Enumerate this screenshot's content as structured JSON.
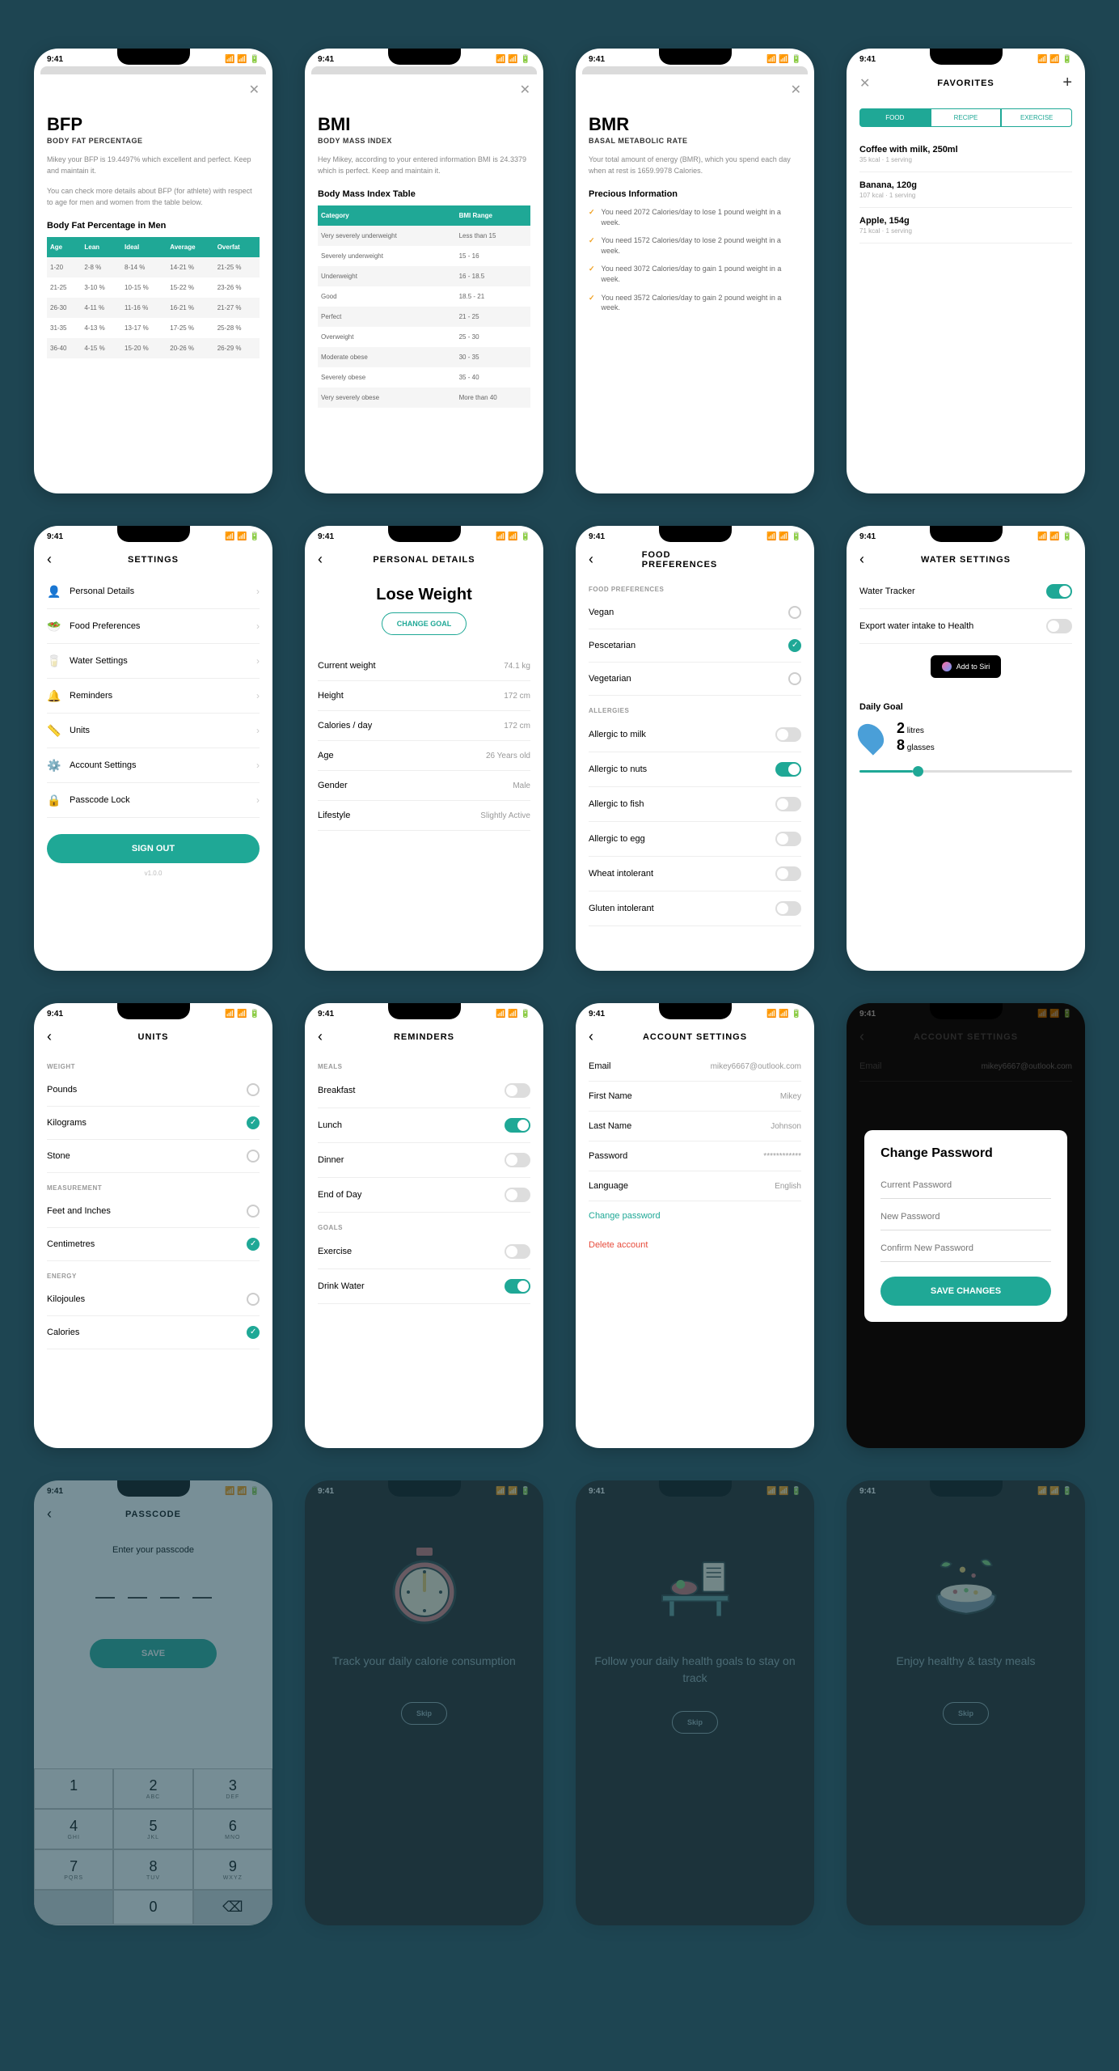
{
  "statusbar": {
    "time": "9:41"
  },
  "bfp": {
    "title": "BFP",
    "subtitle": "BODY FAT PERCENTAGE",
    "desc1": "Mikey your BFP is 19.4497% which excellent and perfect. Keep and maintain it.",
    "desc2": "You can check more details about BFP (for athlete) with respect to age for men and women from the table below.",
    "table_title": "Body Fat Percentage in Men",
    "headers": [
      "Age",
      "Lean",
      "Ideal",
      "Average",
      "Overfat"
    ],
    "rows": [
      [
        "1-20",
        "2-8 %",
        "8-14 %",
        "14-21 %",
        "21-25 %"
      ],
      [
        "21-25",
        "3-10 %",
        "10-15 %",
        "15-22 %",
        "23-26 %"
      ],
      [
        "26-30",
        "4-11 %",
        "11-16 %",
        "16-21 %",
        "21-27 %"
      ],
      [
        "31-35",
        "4-13 %",
        "13-17 %",
        "17-25 %",
        "25-28 %"
      ],
      [
        "36-40",
        "4-15 %",
        "15-20 %",
        "20-26 %",
        "26-29 %"
      ]
    ]
  },
  "bmi": {
    "title": "BMI",
    "subtitle": "BODY MASS INDEX",
    "desc": "Hey Mikey, according to your entered information BMI is 24.3379 which is perfect. Keep and maintain it.",
    "table_title": "Body Mass Index Table",
    "headers": [
      "Category",
      "BMI Range"
    ],
    "rows": [
      [
        "Very severely underweight",
        "Less than 15"
      ],
      [
        "Severely underweight",
        "15 - 16"
      ],
      [
        "Underweight",
        "16 - 18.5"
      ],
      [
        "Good",
        "18.5 - 21"
      ],
      [
        "Perfect",
        "21 - 25"
      ],
      [
        "Overweight",
        "25 - 30"
      ],
      [
        "Moderate obese",
        "30 - 35"
      ],
      [
        "Severely obese",
        "35 - 40"
      ],
      [
        "Very severely obese",
        "More than 40"
      ]
    ]
  },
  "bmr": {
    "title": "BMR",
    "subtitle": "BASAL METABOLIC RATE",
    "desc": "Your total amount of energy (BMR), which you spend each day when at rest is 1659.9978 Calories.",
    "info_title": "Precious Information",
    "items": [
      "You need 2072 Calories/day to lose 1 pound weight in a week.",
      "You need 1572 Calories/day to lose 2 pound weight in a week.",
      "You need 3072 Calories/day to gain 1 pound weight in a week.",
      "You need 3572 Calories/day to gain 2 pound weight in a week."
    ]
  },
  "favorites": {
    "title": "FAVORITES",
    "tabs": [
      "FOOD",
      "RECIPE",
      "EXERCISE"
    ],
    "items": [
      {
        "name": "Coffee with milk, 250ml",
        "meta": "35 kcal · 1 serving"
      },
      {
        "name": "Banana, 120g",
        "meta": "107 kcal · 1 serving"
      },
      {
        "name": "Apple, 154g",
        "meta": "71 kcal · 1 serving"
      }
    ]
  },
  "settings": {
    "title": "SETTINGS",
    "items": [
      "Personal Details",
      "Food Preferences",
      "Water Settings",
      "Reminders",
      "Units",
      "Account Settings",
      "Passcode Lock"
    ],
    "signout": "SIGN OUT",
    "version": "v1.0.0"
  },
  "personal": {
    "title": "PERSONAL DETAILS",
    "goal": "Lose Weight",
    "change": "CHANGE GOAL",
    "rows": [
      {
        "k": "Current weight",
        "v": "74.1 kg"
      },
      {
        "k": "Height",
        "v": "172 cm"
      },
      {
        "k": "Calories / day",
        "v": "172 cm"
      },
      {
        "k": "Age",
        "v": "26 Years old"
      },
      {
        "k": "Gender",
        "v": "Male"
      },
      {
        "k": "Lifestyle",
        "v": "Slightly Active"
      }
    ]
  },
  "foodprefs": {
    "title": "FOOD PREFERENCES",
    "sect1": "FOOD PREFERENCES",
    "prefs": [
      {
        "k": "Vegan",
        "on": false
      },
      {
        "k": "Pescetarian",
        "on": true
      },
      {
        "k": "Vegetarian",
        "on": false
      }
    ],
    "sect2": "ALLERGIES",
    "allergies": [
      {
        "k": "Allergic to milk",
        "on": false
      },
      {
        "k": "Allergic to nuts",
        "on": true
      },
      {
        "k": "Allergic to fish",
        "on": false
      },
      {
        "k": "Allergic to egg",
        "on": false
      },
      {
        "k": "Wheat intolerant",
        "on": false
      },
      {
        "k": "Gluten intolerant",
        "on": false
      }
    ]
  },
  "water": {
    "title": "WATER SETTINGS",
    "rows": [
      {
        "k": "Water Tracker",
        "on": true
      },
      {
        "k": "Export water intake to Health",
        "on": false
      }
    ],
    "siri": "Add to Siri",
    "goal_title": "Daily Goal",
    "litres_n": "2",
    "litres_u": "litres",
    "glasses_n": "8",
    "glasses_u": "glasses"
  },
  "units": {
    "title": "UNITS",
    "weight_label": "WEIGHT",
    "weight": [
      {
        "k": "Pounds",
        "on": false
      },
      {
        "k": "Kilograms",
        "on": true
      },
      {
        "k": "Stone",
        "on": false
      }
    ],
    "meas_label": "MEASUREMENT",
    "meas": [
      {
        "k": "Feet and Inches",
        "on": false
      },
      {
        "k": "Centimetres",
        "on": true
      }
    ],
    "energy_label": "ENERGY",
    "energy": [
      {
        "k": "Kilojoules",
        "on": false
      },
      {
        "k": "Calories",
        "on": true
      }
    ]
  },
  "reminders": {
    "title": "REMINDERS",
    "meals_label": "MEALS",
    "meals": [
      {
        "k": "Breakfast",
        "on": false
      },
      {
        "k": "Lunch",
        "on": true
      },
      {
        "k": "Dinner",
        "on": false
      },
      {
        "k": "End of Day",
        "on": false
      }
    ],
    "goals_label": "GOALS",
    "goals": [
      {
        "k": "Exercise",
        "on": false
      },
      {
        "k": "Drink Water",
        "on": true
      }
    ]
  },
  "account": {
    "title": "ACCOUNT SETTINGS",
    "rows": [
      {
        "k": "Email",
        "v": "mikey6667@outlook.com"
      },
      {
        "k": "First Name",
        "v": "Mikey"
      },
      {
        "k": "Last Name",
        "v": "Johnson"
      },
      {
        "k": "Password",
        "v": "************"
      },
      {
        "k": "Language",
        "v": "English"
      }
    ],
    "change_pw": "Change password",
    "delete": "Delete account"
  },
  "changepw": {
    "title": "Change Password",
    "f1": "Current Password",
    "f2": "New Password",
    "f3": "Confirm New Password",
    "save": "SAVE CHANGES"
  },
  "passcode": {
    "title": "PASSCODE",
    "prompt": "Enter your passcode",
    "save": "SAVE",
    "keys": [
      {
        "n": "1",
        "l": ""
      },
      {
        "n": "2",
        "l": "ABC"
      },
      {
        "n": "3",
        "l": "DEF"
      },
      {
        "n": "4",
        "l": "GHI"
      },
      {
        "n": "5",
        "l": "JKL"
      },
      {
        "n": "6",
        "l": "MNO"
      },
      {
        "n": "7",
        "l": "PQRS"
      },
      {
        "n": "8",
        "l": "TUV"
      },
      {
        "n": "9",
        "l": "WXYZ"
      },
      {
        "n": "",
        "l": ""
      },
      {
        "n": "0",
        "l": ""
      },
      {
        "n": "⌫",
        "l": ""
      }
    ]
  },
  "onboard1": "Track your daily calorie consumption",
  "onboard2": "Follow your daily health goals to stay on track",
  "onboard3": "Enjoy healthy & tasty meals",
  "skip": "Skip"
}
